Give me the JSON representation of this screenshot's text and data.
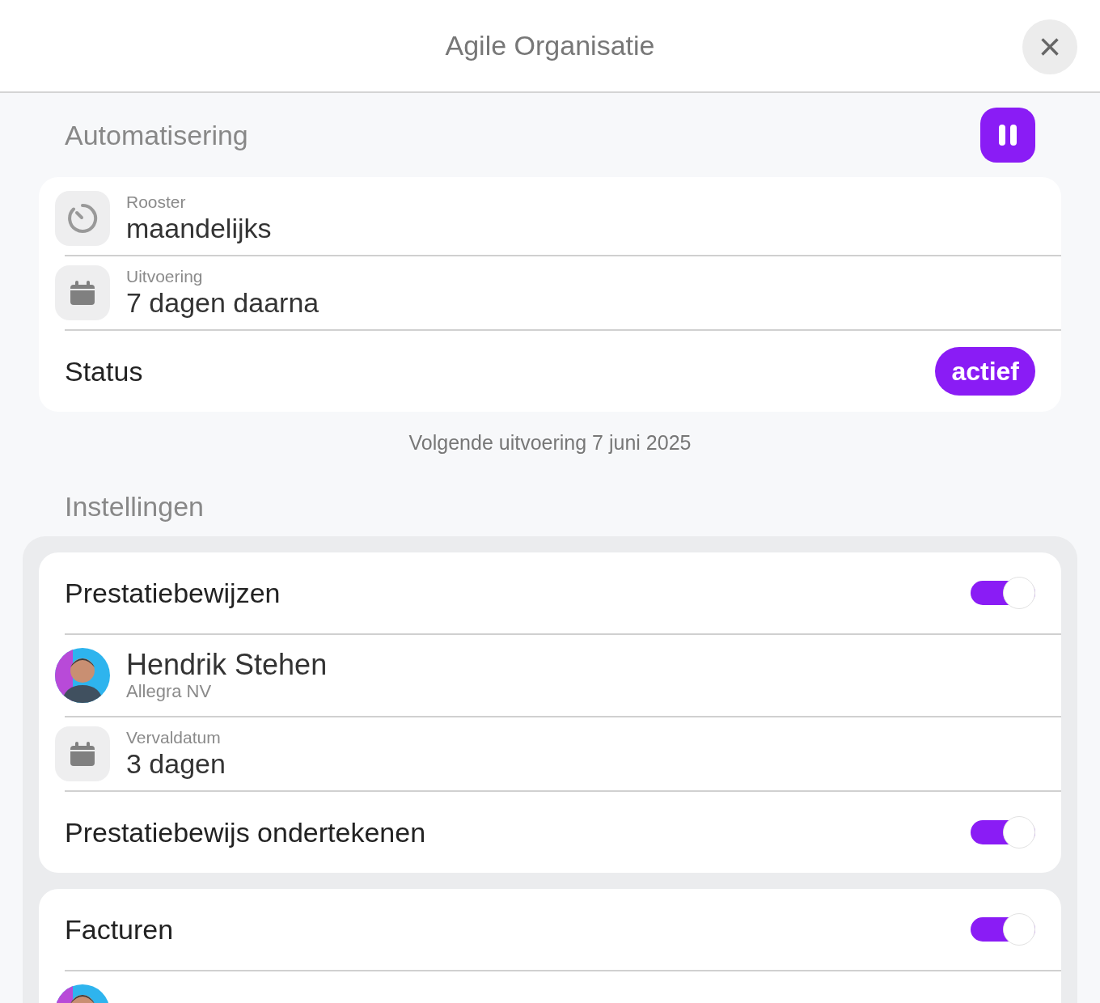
{
  "window": {
    "title": "Agile Organisatie",
    "close": "×"
  },
  "automation": {
    "heading": "Automatisering",
    "paused": false,
    "rows": [
      {
        "kind": "schedule",
        "label": "Rooster",
        "value": "maandelijks"
      },
      {
        "kind": "date",
        "label": "Uitvoering",
        "value": "7 dagen daarna"
      },
      {
        "kind": "status",
        "label": "Status",
        "value": "actief"
      }
    ],
    "next_run": "Volgende uitvoering 7 juni 2025"
  },
  "settings": {
    "heading": "Instellingen",
    "groups": [
      {
        "items": [
          {
            "kind": "toggle",
            "label": "Prestatiebewijzen",
            "on": true
          },
          {
            "kind": "person",
            "name": "Hendrik Stehen",
            "company": "Allegra NV"
          },
          {
            "kind": "date",
            "label": "Vervaldatum",
            "value": "3 dagen"
          },
          {
            "kind": "toggle",
            "label": "Prestatiebewijs ondertekenen",
            "on": true
          }
        ]
      },
      {
        "items": [
          {
            "kind": "toggle",
            "label": "Facturen",
            "on": true
          },
          {
            "kind": "person"
          }
        ]
      }
    ]
  }
}
